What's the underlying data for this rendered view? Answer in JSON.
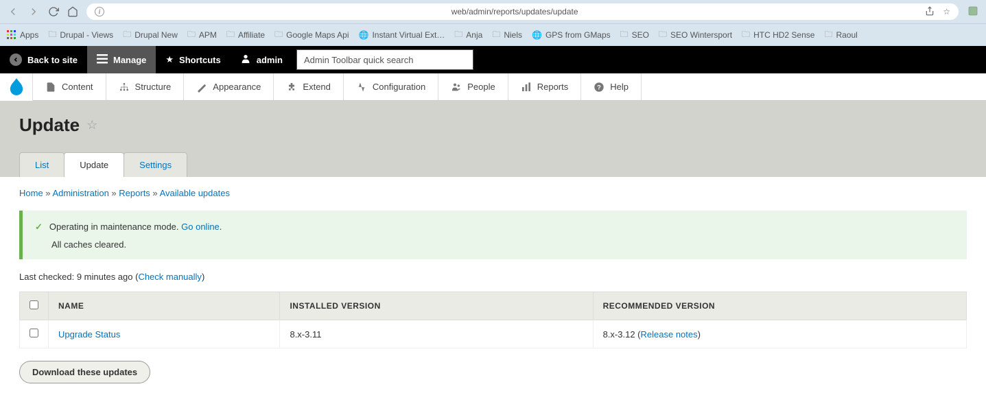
{
  "browser": {
    "url": "web/admin/reports/updates/update"
  },
  "bookmarks": [
    {
      "label": "Apps",
      "icon": "apps"
    },
    {
      "label": "Drupal - Views",
      "icon": "folder"
    },
    {
      "label": "Drupal New",
      "icon": "folder"
    },
    {
      "label": "APM",
      "icon": "folder"
    },
    {
      "label": "Affiliate",
      "icon": "folder"
    },
    {
      "label": "Google Maps Api",
      "icon": "folder"
    },
    {
      "label": "Instant Virtual Ext…",
      "icon": "globe"
    },
    {
      "label": "Anja",
      "icon": "folder"
    },
    {
      "label": "Niels",
      "icon": "folder"
    },
    {
      "label": "GPS from GMaps",
      "icon": "globe"
    },
    {
      "label": "SEO",
      "icon": "folder"
    },
    {
      "label": "SEO Wintersport",
      "icon": "folder"
    },
    {
      "label": "HTC HD2 Sense",
      "icon": "folder"
    },
    {
      "label": "Raoul",
      "icon": "folder"
    }
  ],
  "toolbar": {
    "back": "Back to site",
    "manage": "Manage",
    "shortcuts": "Shortcuts",
    "admin": "admin",
    "search_placeholder": "Admin Toolbar quick search"
  },
  "admin_menu": [
    {
      "label": "Content"
    },
    {
      "label": "Structure"
    },
    {
      "label": "Appearance"
    },
    {
      "label": "Extend"
    },
    {
      "label": "Configuration"
    },
    {
      "label": "People"
    },
    {
      "label": "Reports"
    },
    {
      "label": "Help"
    }
  ],
  "page": {
    "title": "Update"
  },
  "tabs": [
    {
      "label": "List"
    },
    {
      "label": "Update"
    },
    {
      "label": "Settings"
    }
  ],
  "breadcrumb": {
    "home": "Home",
    "admin": "Administration",
    "reports": "Reports",
    "updates": "Available updates"
  },
  "status": {
    "line1_text": "Operating in maintenance mode. ",
    "line1_link": "Go online",
    "line1_suffix": ".",
    "line2": "All caches cleared."
  },
  "checked": {
    "prefix": "Last checked: 9 minutes ago (",
    "link": "Check manually",
    "suffix": ")"
  },
  "table": {
    "headers": {
      "name": "NAME",
      "installed": "INSTALLED VERSION",
      "recommended": "RECOMMENDED VERSION"
    },
    "rows": [
      {
        "name": "Upgrade Status",
        "installed": "8.x-3.11",
        "recommended_ver": "8.x-3.12",
        "release_notes": "Release notes"
      }
    ]
  },
  "buttons": {
    "download": "Download these updates"
  }
}
